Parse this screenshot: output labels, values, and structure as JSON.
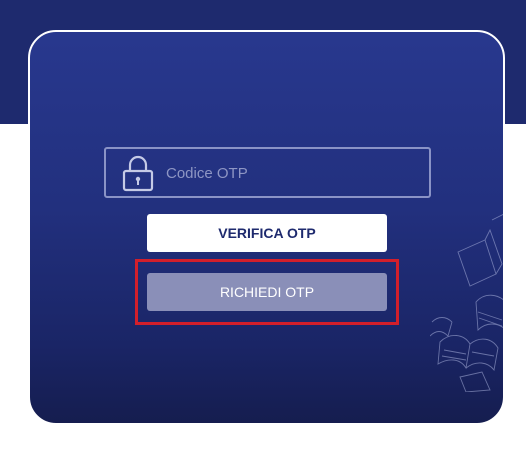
{
  "otp": {
    "placeholder": "Codice OTP",
    "value": ""
  },
  "buttons": {
    "verify_label": "VERIFICA OTP",
    "request_label": "RICHIEDI OTP"
  },
  "icons": {
    "lock": "lock-icon",
    "decoration": "flying-books-decoration"
  },
  "colors": {
    "background_top": "#1e2a6e",
    "card_gradient_start": "#28388e",
    "card_gradient_end": "#151d4f",
    "verify_button_bg": "#ffffff",
    "request_button_bg": "#8a8fb8",
    "highlight_border": "#d21f2b"
  }
}
